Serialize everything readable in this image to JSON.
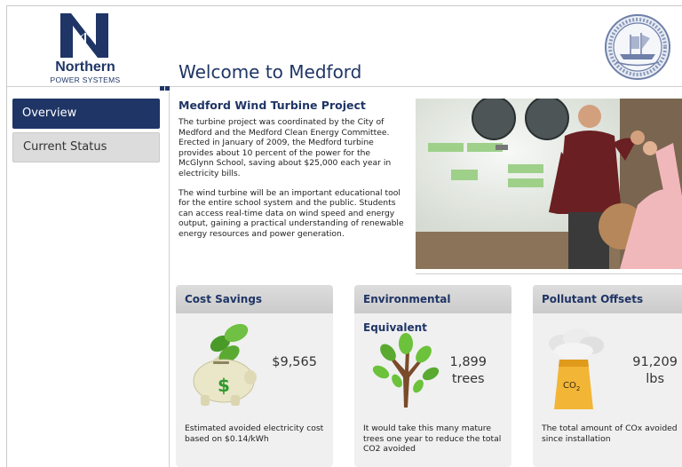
{
  "header": {
    "brand_name": "Northern",
    "brand_sub": "POWER SYSTEMS",
    "page_title": "Welcome to Medford"
  },
  "sidebar": {
    "items": [
      {
        "label": "Overview",
        "active": true
      },
      {
        "label": "Current Status",
        "active": false
      }
    ]
  },
  "intro": {
    "title": "Medford Wind Turbine Project",
    "paragraph1": "The turbine project was coordinated by the City of Medford and the Medford Clean Energy Committee. Erected in January of 2009, the Medford turbine provides about 10 percent of the power for the McGlynn School, saving about $25,000 each year in electricity bills.",
    "paragraph2": "The wind turbine will be an important educational tool for the entire school system and the public. Students can access real-time data on wind speed and energy output, gaining a practical understanding of renewable energy resources and power generation."
  },
  "cards": [
    {
      "title": "Cost Savings",
      "value": "$9,565",
      "unit": "",
      "desc": "Estimated avoided electricity cost based on $0.14/kWh",
      "icon": "piggy-bank-icon"
    },
    {
      "title": "Environmental Equivalent",
      "value": "1,899",
      "unit": "trees",
      "desc": "It would take this many mature trees one year to reduce the total CO2 avoided",
      "icon": "tree-icon"
    },
    {
      "title": "Pollutant Offsets",
      "value": "91,209",
      "unit": "lbs",
      "desc": "The total amount of COx avoided since installation",
      "icon": "smokestack-icon",
      "icon_text": "CO",
      "icon_subscript": "2"
    }
  ],
  "colors": {
    "navy": "#1f3566",
    "card_bg": "#f0f0f0",
    "green": "#5aa832"
  }
}
